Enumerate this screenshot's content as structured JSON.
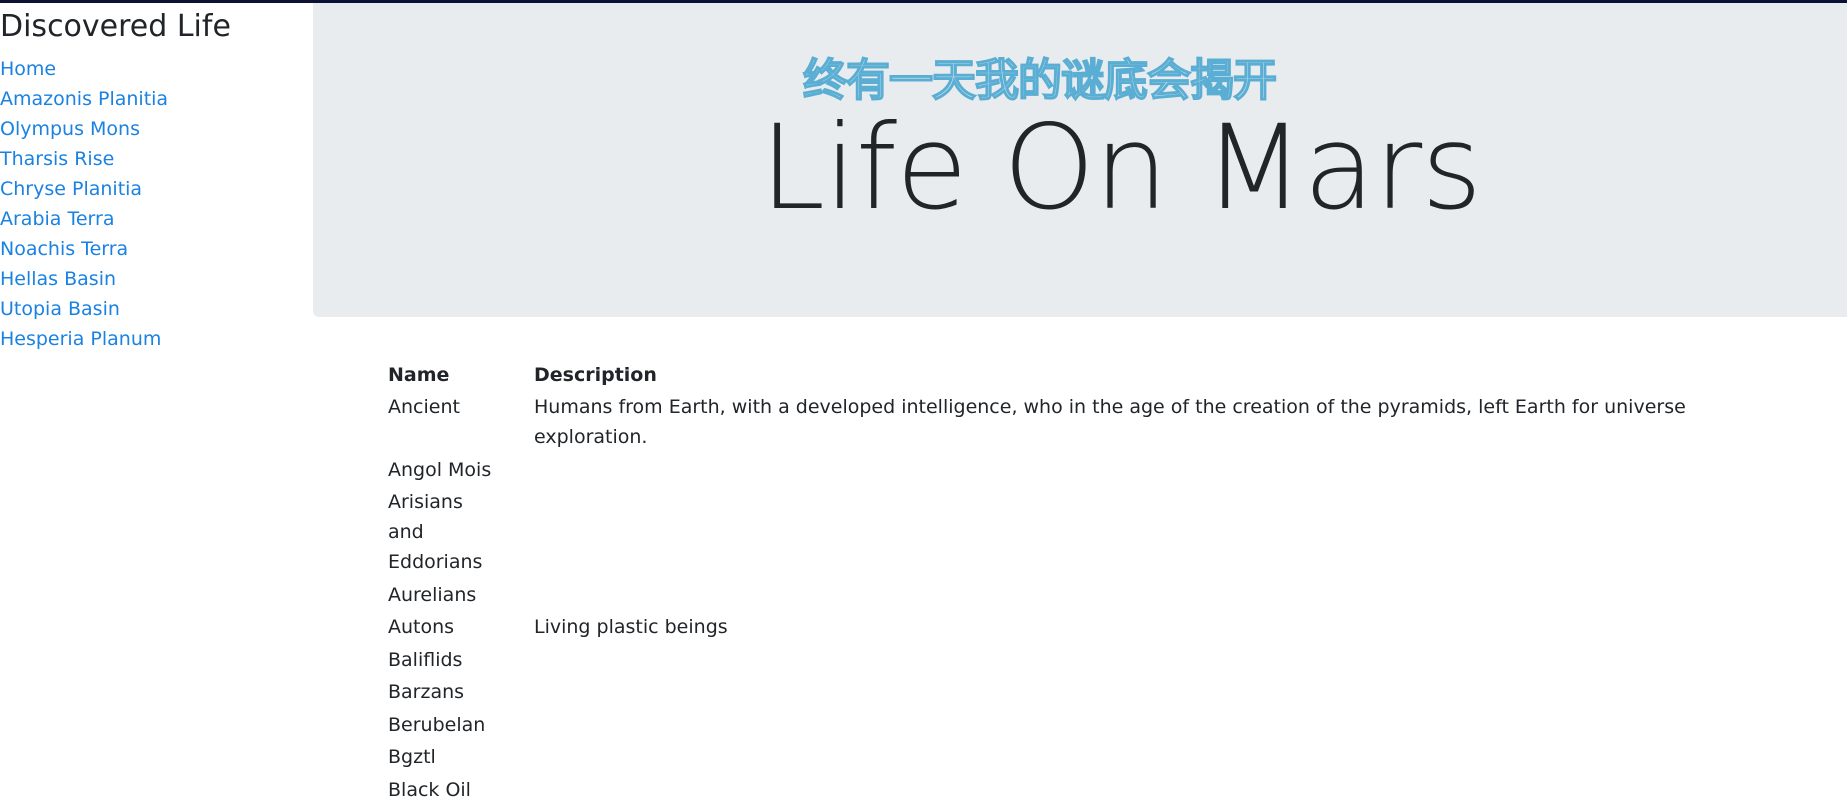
{
  "sidebar": {
    "title": "Discovered Life",
    "links": [
      "Home",
      "Amazonis Planitia",
      "Olympus Mons",
      "Tharsis Rise",
      "Chryse Planitia",
      "Arabia Terra",
      "Noachis Terra",
      "Hellas Basin",
      "Utopia Basin",
      "Hesperia Planum"
    ]
  },
  "hero": {
    "subtitle": "终有一天我的谜底会揭开",
    "title": "Life On Mars"
  },
  "table": {
    "headers": [
      "Name",
      "Description"
    ],
    "rows": [
      {
        "name": "Ancient",
        "description": "Humans from Earth, with a developed intelligence, who in the age of the creation of the pyramids, left Earth for universe exploration."
      },
      {
        "name": "Angol Mois",
        "description": ""
      },
      {
        "name": "Arisians and Eddorians",
        "description": ""
      },
      {
        "name": "Aurelians",
        "description": ""
      },
      {
        "name": "Autons",
        "description": "Living plastic beings"
      },
      {
        "name": "Baliflids",
        "description": ""
      },
      {
        "name": "Barzans",
        "description": ""
      },
      {
        "name": "Berubelan",
        "description": ""
      },
      {
        "name": "Bgztl",
        "description": ""
      },
      {
        "name": "Black Oil",
        "description": ""
      }
    ]
  },
  "colors": {
    "link": "#1a82e2",
    "hero_bg": "#e9ecef",
    "topbar": "#0b1233"
  }
}
